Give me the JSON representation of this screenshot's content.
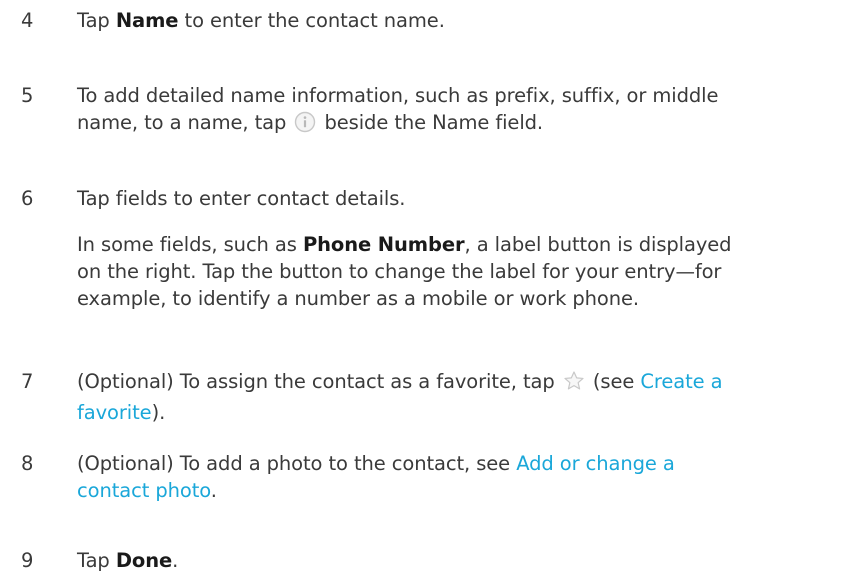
{
  "steps": [
    {
      "number": "4",
      "line1": {
        "pre": "Tap ",
        "bold": "Name",
        "post": " to enter the contact name."
      }
    },
    {
      "number": "5",
      "line1": "To add detailed name information, such as prefix, suffix, or middle",
      "line2": {
        "pre": "name, to a name, tap ",
        "post": " beside the Name field."
      },
      "icon": "info-icon"
    },
    {
      "number": "6",
      "line1": "Tap fields to enter contact details.",
      "note": {
        "line1": {
          "pre": "In some fields, such as ",
          "bold": "Phone Number",
          "post": ", a label button is displayed"
        },
        "line2": "on the right. Tap the button to change the label for your entry—for",
        "line3": "example, to identify a number as a mobile or work phone."
      }
    },
    {
      "number": "7",
      "line1": {
        "pre": "(Optional) To assign the contact as a favorite, tap ",
        "mid": " (see ",
        "link": "Create a"
      },
      "line2": {
        "link": "favorite",
        "post": ")."
      },
      "icon": "star-icon"
    },
    {
      "number": "8",
      "line1": {
        "pre": "(Optional) To add a photo to the contact, see ",
        "link": "Add or change a"
      },
      "line2": {
        "link": "contact photo",
        "post": "."
      }
    },
    {
      "number": "9",
      "line1": {
        "pre": "Tap ",
        "bold": "Done",
        "post": "."
      }
    }
  ],
  "colors": {
    "text": "#3a3a3a",
    "link": "#1aa7d9",
    "icon": "#c8c8c8"
  }
}
